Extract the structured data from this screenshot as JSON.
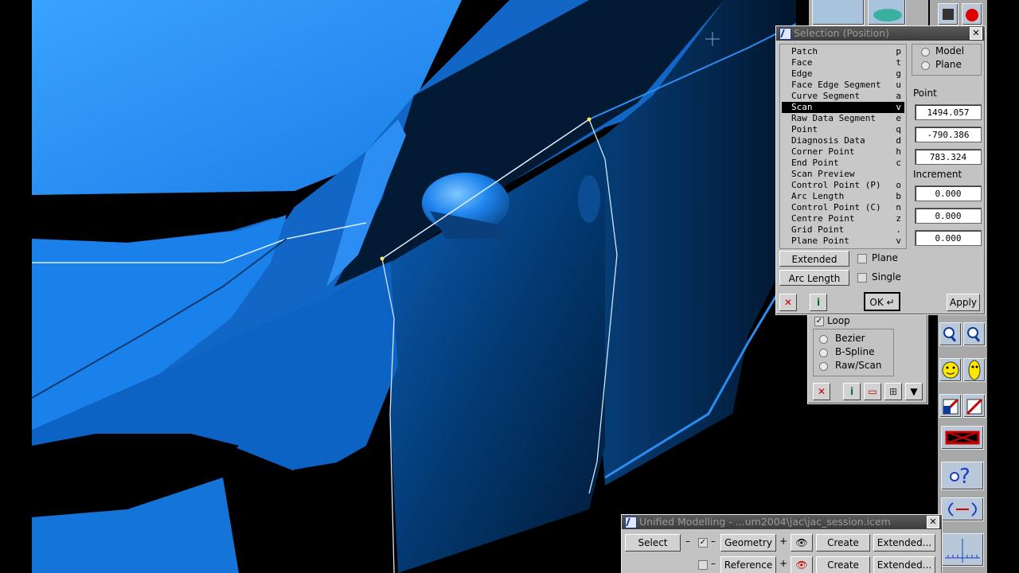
{
  "selection_dialog": {
    "title": "Selection (Position)",
    "list_items": [
      {
        "label": "Patch",
        "key": "p"
      },
      {
        "label": "Face",
        "key": "t"
      },
      {
        "label": "Edge",
        "key": "g"
      },
      {
        "label": "Face Edge Segment",
        "key": "u"
      },
      {
        "label": "Curve Segment",
        "key": "a"
      },
      {
        "label": "Scan",
        "key": "v",
        "selected": true
      },
      {
        "label": "Raw Data Segment",
        "key": "e"
      },
      {
        "label": "Point",
        "key": "q"
      },
      {
        "label": "Diagnosis Data",
        "key": "d"
      },
      {
        "label": "Corner Point",
        "key": "h"
      },
      {
        "label": "End Point",
        "key": "c"
      },
      {
        "label": "Scan Preview",
        "key": ""
      },
      {
        "label": "Control Point (P)",
        "key": "o"
      },
      {
        "label": "Arc Length",
        "key": "b"
      },
      {
        "label": "Control Point (C)",
        "key": "n"
      },
      {
        "label": "Centre Point",
        "key": "z"
      },
      {
        "label": "Grid Point",
        "key": "."
      },
      {
        "label": "Plane Point",
        "key": "v"
      }
    ],
    "mode_model": "Model",
    "mode_plane": "Plane",
    "point_label": "Point",
    "point_x": "1494.057",
    "point_y": "-790.386",
    "point_z": "783.324",
    "increment_label": "Increment",
    "inc_1": "0.000",
    "inc_2": "0.000",
    "inc_3": "0.000",
    "extended_label": "Extended",
    "plane_check_label": "Plane",
    "arc_length_label": "Arc Length",
    "single_check_label": "Single",
    "ok_label": "OK ↵",
    "apply_label": "Apply"
  },
  "curve_panel": {
    "loop_label": "Loop",
    "bezier_label": "Bezier",
    "bspline_label": "B-Spline",
    "rawscan_label": "Raw/Scan"
  },
  "unified_modelling": {
    "title": "Unified Modelling - ...um2004\\jac\\jac_session.icem",
    "select_label": "Select",
    "geometry_label": "Geometry",
    "reference_label": "Reference",
    "create_label_1": "Create",
    "create_label_2": "Create",
    "extended_label_1": "Extended...",
    "extended_label_2": "Extended...",
    "dash": "–",
    "plus": "+",
    "check": "✓"
  },
  "colors": {
    "body_blue": "#1a7ee6",
    "body_dark": "#02264d",
    "panel_grey": "#c3c3c3"
  }
}
